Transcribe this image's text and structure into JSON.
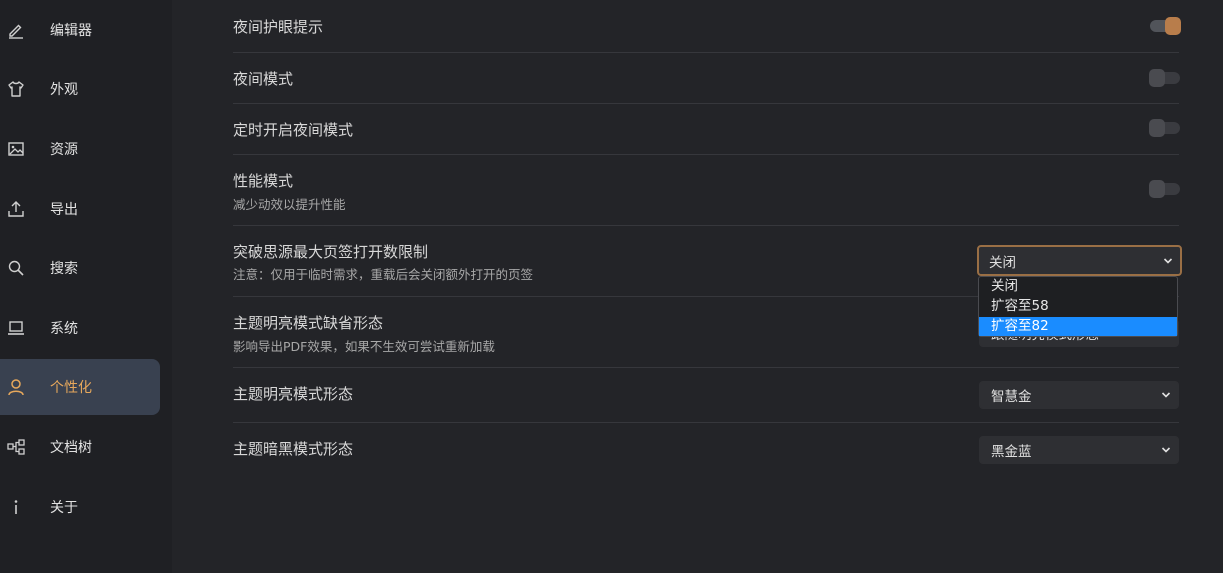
{
  "sidebar": {
    "items": [
      {
        "label": "编辑器",
        "icon": "pencil-icon"
      },
      {
        "label": "外观",
        "icon": "shirt-icon"
      },
      {
        "label": "资源",
        "icon": "image-icon"
      },
      {
        "label": "导出",
        "icon": "upload-icon"
      },
      {
        "label": "搜索",
        "icon": "search-icon"
      },
      {
        "label": "系统",
        "icon": "laptop-icon"
      },
      {
        "label": "个性化",
        "icon": "user-icon",
        "active": true
      },
      {
        "label": "文档树",
        "icon": "tree-icon"
      },
      {
        "label": "关于",
        "icon": "info-icon"
      }
    ]
  },
  "settings": {
    "night_eye_care": {
      "title": "夜间护眼提示",
      "enabled": true
    },
    "night_mode": {
      "title": "夜间模式",
      "enabled": false
    },
    "scheduled_night_mode": {
      "title": "定时开启夜间模式",
      "enabled": false
    },
    "performance_mode": {
      "title": "性能模式",
      "desc": "减少动效以提升性能",
      "enabled": false
    },
    "tab_limit": {
      "title": "突破思源最大页签打开数限制",
      "desc": "注意：仅用于临时需求，重载后会关闭额外打开的页签",
      "value": "关闭",
      "options": [
        "关闭",
        "扩容至58",
        "扩容至82"
      ],
      "highlighted_option": "扩容至82"
    },
    "light_default": {
      "title": "主题明亮模式缺省形态",
      "desc": "影响导出PDF效果，如果不生效可尝试重新加载",
      "value": "跟随明亮模式形态"
    },
    "light_form": {
      "title": "主题明亮模式形态",
      "value": "智慧金"
    },
    "dark_form": {
      "title": "主题暗黑模式形态",
      "value": "黑金蓝"
    }
  },
  "colors": {
    "accent": "#e7a85c",
    "toggle_on": "#b87d4b",
    "dropdown_highlight": "#1a8cff",
    "active_sidebar_bg": "#394150"
  }
}
